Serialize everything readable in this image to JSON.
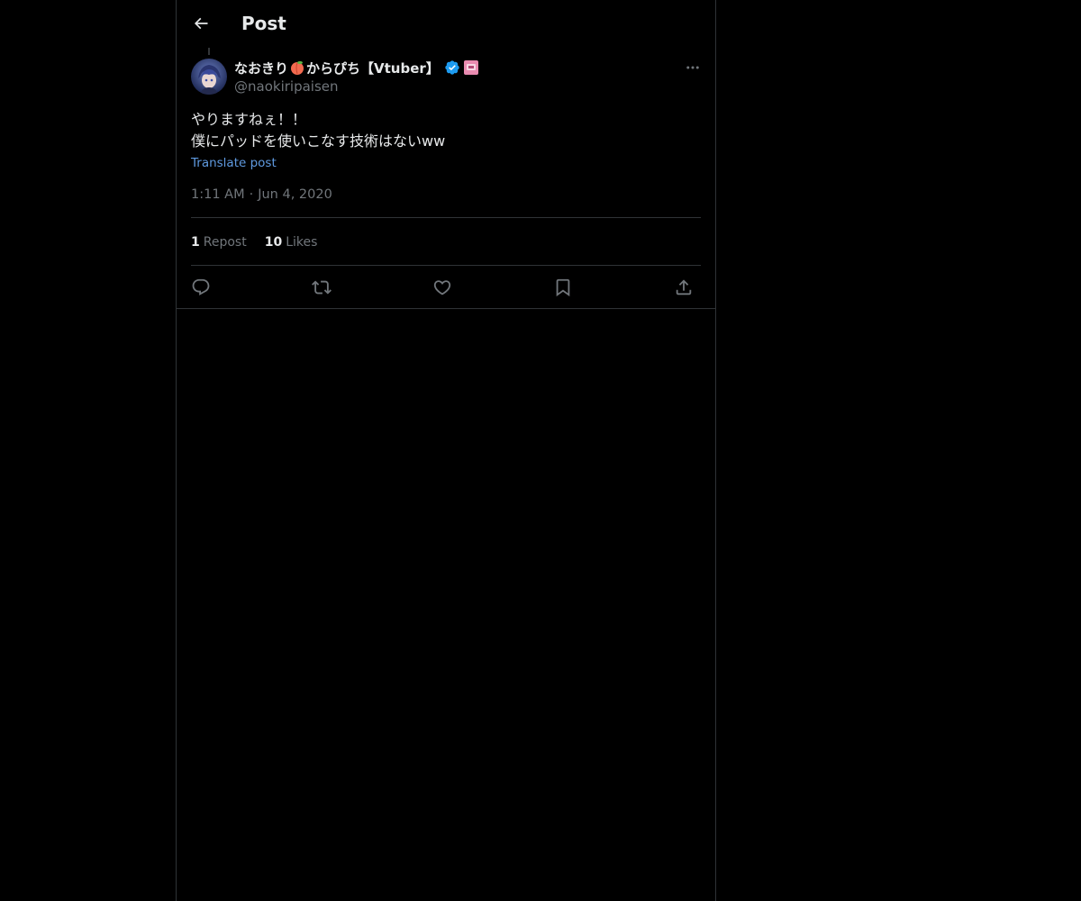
{
  "header": {
    "title": "Post"
  },
  "author": {
    "name_prefix": "なおきり",
    "name_suffix": "からぴち【Vtuber】",
    "handle": "@naokiripaisen"
  },
  "post": {
    "lines": [
      "やりますねぇ！！",
      "僕にパッドを使いこなす技術はないww"
    ],
    "translate_label": "Translate post",
    "time": "1:11 AM",
    "separator": "·",
    "date": "Jun 4, 2020"
  },
  "stats": {
    "reposts_count": "1",
    "reposts_label": "Repost",
    "likes_count": "10",
    "likes_label": "Likes"
  },
  "icons": {
    "back": "arrow-left-icon",
    "verified": "verified-badge-icon",
    "affiliate": "affiliate-badge-icon",
    "more": "more-icon",
    "reply": "reply-icon",
    "repost": "repost-icon",
    "like": "heart-icon",
    "bookmark": "bookmark-icon",
    "share": "share-icon"
  },
  "colors": {
    "background": "#000000",
    "text": "#e7e9ea",
    "secondary": "#71767b",
    "link": "#5f9ae0",
    "verified": "#1d9bf0",
    "border": "#2f3336"
  }
}
